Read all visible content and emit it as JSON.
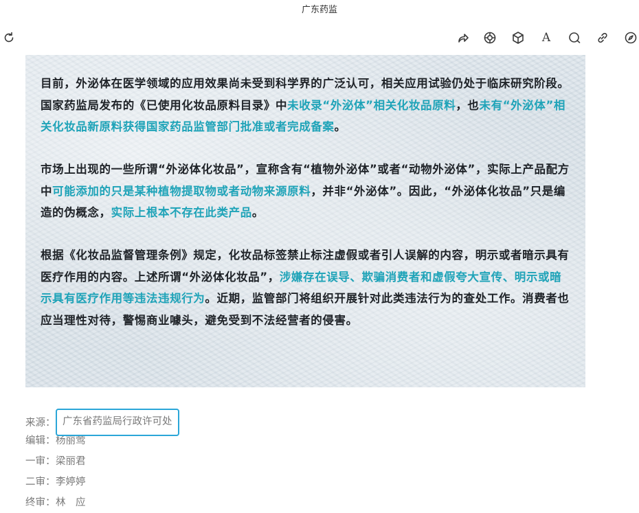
{
  "window": {
    "title": "广东药监"
  },
  "toolbar": {
    "icons": [
      "refresh-icon",
      "share-icon",
      "target-icon",
      "cube-icon",
      "font-size-icon",
      "comment-icon",
      "link-icon",
      "compass-icon"
    ],
    "font_label": "A"
  },
  "article": {
    "p1": {
      "a": "目前，外泌体在医学领域的应用效果尚未受到科学界的广泛认可，相关应用试验仍处于临床研究阶段。国家药监局发布的《已使用化妆品原料目录》中",
      "b": "未收录“外泌体”相关化妆品原料",
      "c": "，也",
      "d": "未有“外泌体”相关化妆品新原料获得国家药品监管部门批准或者完成备案",
      "e": "。"
    },
    "p2": {
      "a": "市场上出现的一些所谓“外泌体化妆品”，宣称含有“植物外泌体”或者“动物外泌体”，实际上产品配方中",
      "b": "可能添加的只是某种植物提取物或者动物来源原料",
      "c": "，并非“外泌体”。因此，“外泌体化妆品”只是编造的伪概念，",
      "d": "实际上根本不存在此类产品",
      "e": "。"
    },
    "p3": {
      "a": "根据《化妆品监督管理条例》规定，化妆品标签禁止标注虚假或者引人误解的内容，明示或者暗示具有医疗作用的内容。上述所谓“外泌体化妆品”，",
      "b": "涉嫌存在误导、欺骗消费者和虚假夸大宣传、明示或暗示具有医疗作用等违法违规行为",
      "c": "。近期，监管部门将组织开展针对此类违法行为的查处工作。消费者也应当理性对待，警惕商业噱头，避免受到不法经营者的侵害。"
    }
  },
  "credits": {
    "source_label": "来源：",
    "source_value": "广东省药监局行政许可处",
    "editor_label": "编辑：",
    "editor_value": "杨丽莺",
    "review1_label": "一审：",
    "review1_value": "梁丽君",
    "review2_label": "二审：",
    "review2_value": "李婷婷",
    "final_label": "终审：",
    "final_value": "林　应"
  },
  "colors": {
    "highlight": "#1fa3b8",
    "source_border": "#2aa6d8"
  }
}
